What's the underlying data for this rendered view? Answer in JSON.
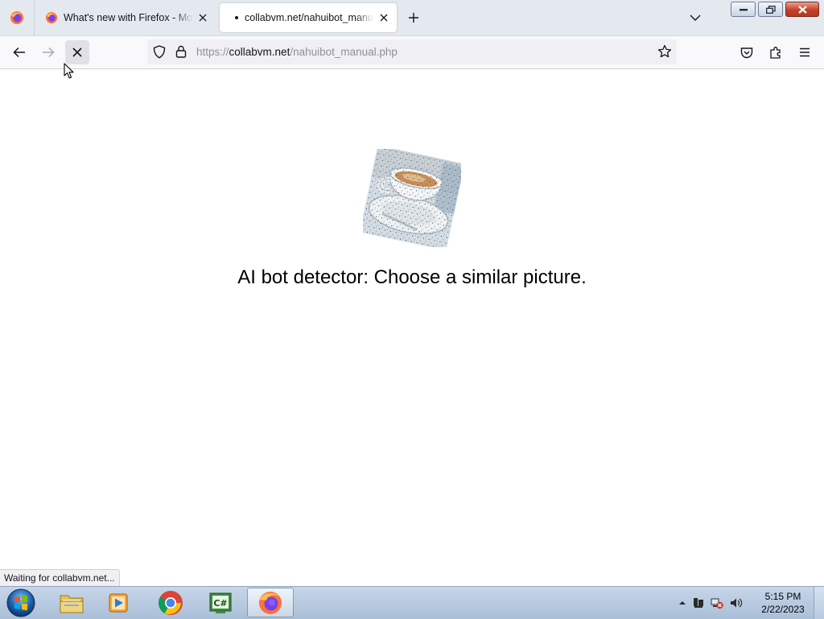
{
  "tabs": [
    {
      "title": "What's new with Firefox - More",
      "active": false
    },
    {
      "title": "collabvm.net/nahuibot_manual.php",
      "active": true,
      "loading": true
    }
  ],
  "navbar": {
    "url_scheme": "https://",
    "url_host": "collabvm.net",
    "url_path": "/nahuibot_manual.php"
  },
  "page": {
    "captcha_prompt": "AI bot detector: Choose a similar picture."
  },
  "status_text": "Waiting for collabvm.net...",
  "taskbar": {
    "time": "5:15 PM",
    "date": "2/22/2023",
    "apps": [
      "windows-explorer",
      "media-player",
      "chrome",
      "csharp-ide",
      "firefox"
    ]
  },
  "colors": {
    "accent": "#0060df",
    "tabstrip_bg": "#e4e9f0",
    "taskbar_bg": "#b5c8de"
  }
}
